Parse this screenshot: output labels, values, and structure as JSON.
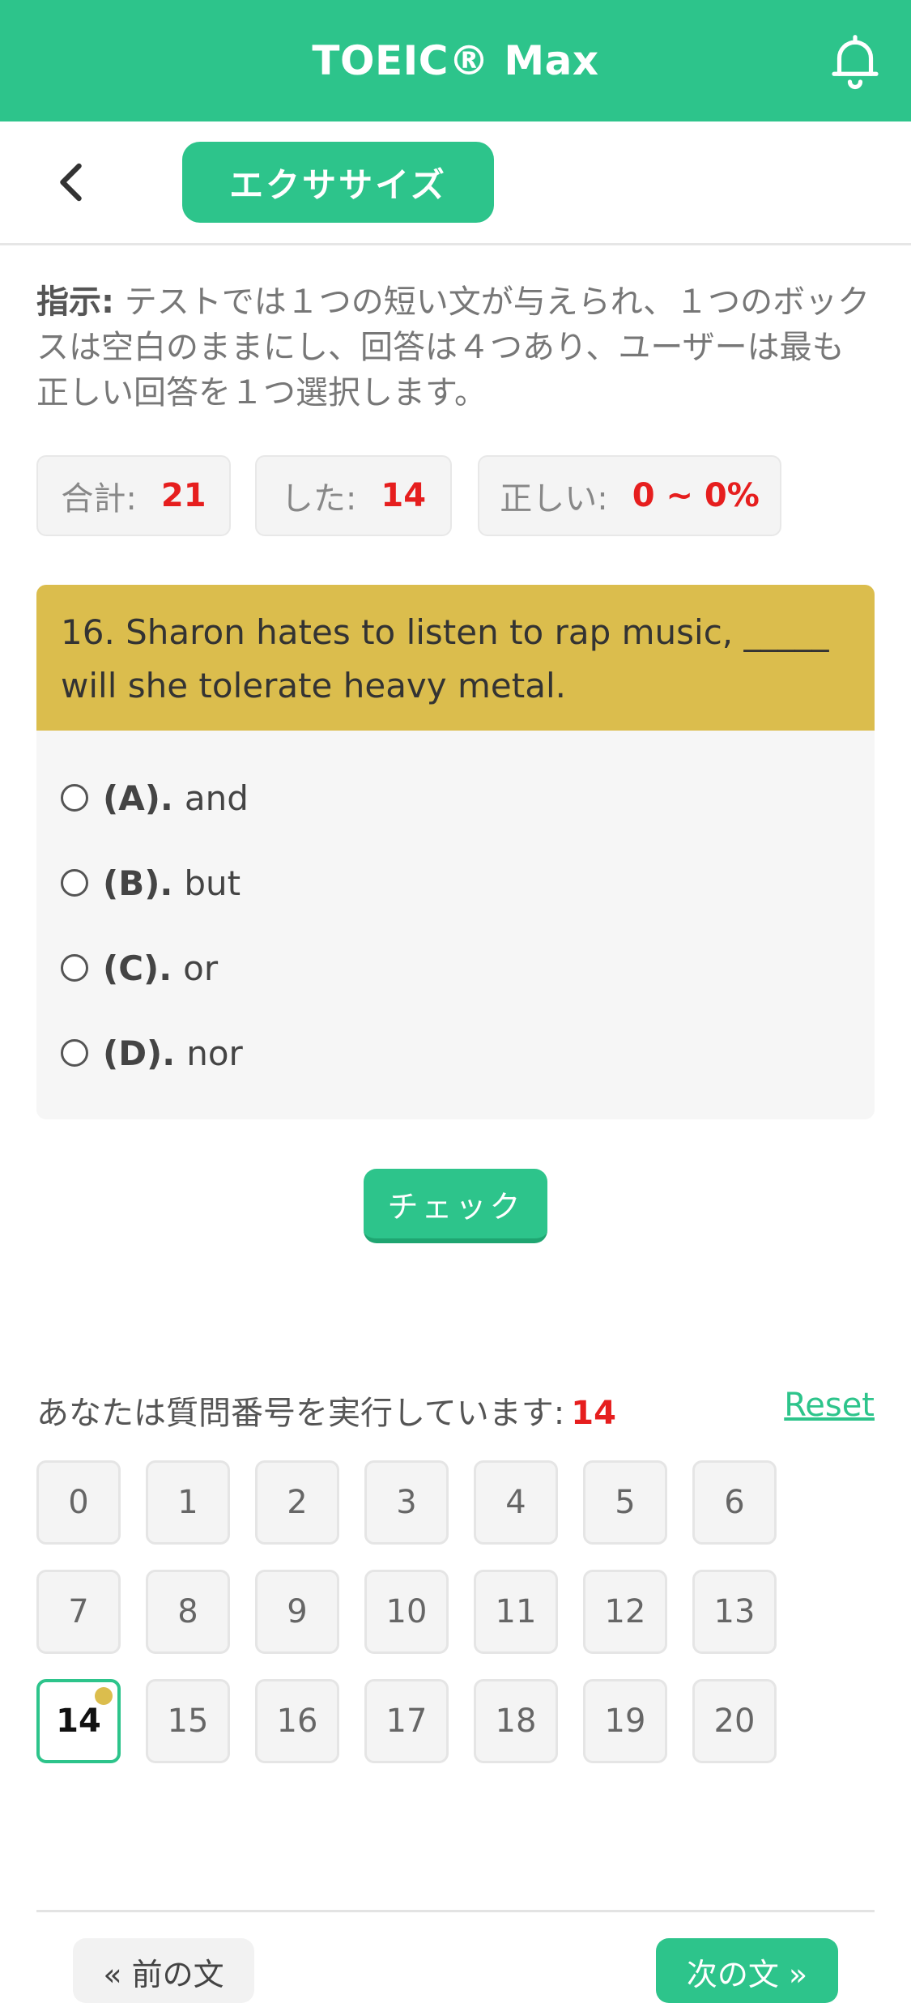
{
  "app": {
    "title": "TOEIC® Max"
  },
  "header": {
    "mode_label": "エクササイズ"
  },
  "instruction": {
    "label": "指示:",
    "text": " テストでは１つの短い文が与えられ、１つのボックスは空白のままにし、回答は４つあり、ユーザーは最も正しい回答を１つ選択します。"
  },
  "stats": [
    {
      "label": "合計:",
      "value": "21"
    },
    {
      "label": "した:",
      "value": "14"
    },
    {
      "label": "正しい:",
      "value": "0 ~ 0%"
    }
  ],
  "question": {
    "text": "16. Sharon hates to listen to rap music, _____ will she tolerate heavy metal.",
    "options": [
      {
        "letter": "(A).",
        "text": "and"
      },
      {
        "letter": "(B).",
        "text": "but"
      },
      {
        "letter": "(C).",
        "text": "or"
      },
      {
        "letter": "(D).",
        "text": "nor"
      }
    ]
  },
  "check_label": "チェック",
  "progress": {
    "label": "あなたは質問番号を実行しています:",
    "current": "14",
    "reset_label": "Reset",
    "numbers": [
      "0",
      "1",
      "2",
      "3",
      "4",
      "5",
      "6",
      "7",
      "8",
      "9",
      "10",
      "11",
      "12",
      "13",
      "14",
      "15",
      "16",
      "17",
      "18",
      "19",
      "20"
    ]
  },
  "nav": {
    "prev_label": "« 前の文",
    "next_label": "次の文 »"
  },
  "colors": {
    "accent": "#2dc48b",
    "question_header": "#dbbd4d",
    "highlight": "#e61e1e"
  }
}
